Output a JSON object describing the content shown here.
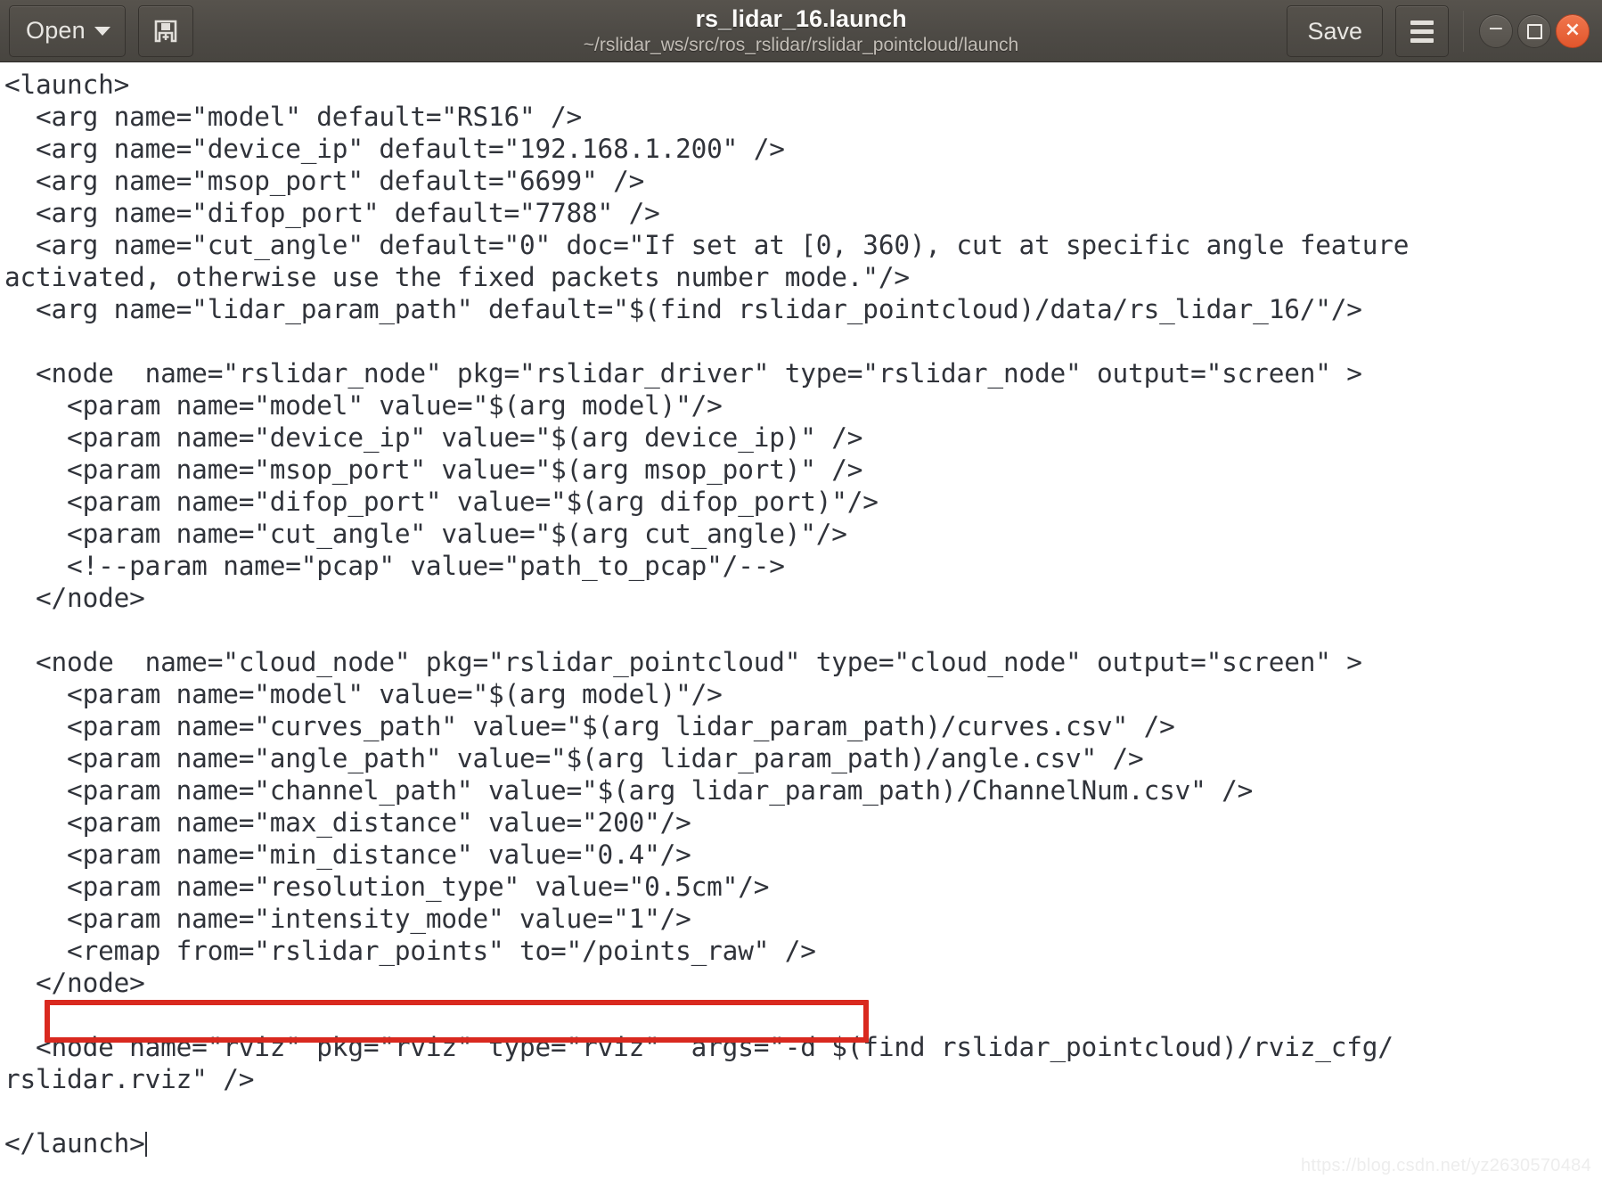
{
  "titlebar": {
    "open_label": "Open",
    "open_icon": "chevron-down-icon",
    "new_doc_icon": "save-as-document-icon",
    "title": "rs_lidar_16.launch",
    "path": "~/rslidar_ws/src/ros_rslidar/rslidar_pointcloud/launch",
    "save_label": "Save",
    "menu_icon": "hamburger-menu-icon",
    "minimize_glyph": "−",
    "maximize_glyph": "□",
    "close_glyph": "×",
    "colors": {
      "bar_background": "#4d4a45",
      "close_button": "#e2562c",
      "text": "#fbfaf8"
    }
  },
  "editor": {
    "colors": {
      "background": "#ffffff",
      "text": "#30333a",
      "highlight_border": "#d9291f"
    },
    "highlight": {
      "target_line": "<remap from=\"rslidar_points\" to=\"/points_raw\" />"
    },
    "content": "<launch>\n  <arg name=\"model\" default=\"RS16\" />\n  <arg name=\"device_ip\" default=\"192.168.1.200\" />\n  <arg name=\"msop_port\" default=\"6699\" />\n  <arg name=\"difop_port\" default=\"7788\" />\n  <arg name=\"cut_angle\" default=\"0\" doc=\"If set at [0, 360), cut at specific angle feature\nactivated, otherwise use the fixed packets number mode.\"/>\n  <arg name=\"lidar_param_path\" default=\"$(find rslidar_pointcloud)/data/rs_lidar_16/\"/>\n\n  <node  name=\"rslidar_node\" pkg=\"rslidar_driver\" type=\"rslidar_node\" output=\"screen\" >\n    <param name=\"model\" value=\"$(arg model)\"/>\n    <param name=\"device_ip\" value=\"$(arg device_ip)\" />\n    <param name=\"msop_port\" value=\"$(arg msop_port)\" />\n    <param name=\"difop_port\" value=\"$(arg difop_port)\"/>\n    <param name=\"cut_angle\" value=\"$(arg cut_angle)\"/>\n    <!--param name=\"pcap\" value=\"path_to_pcap\"/-->\n  </node>\n\n  <node  name=\"cloud_node\" pkg=\"rslidar_pointcloud\" type=\"cloud_node\" output=\"screen\" >\n    <param name=\"model\" value=\"$(arg model)\"/>\n    <param name=\"curves_path\" value=\"$(arg lidar_param_path)/curves.csv\" />\n    <param name=\"angle_path\" value=\"$(arg lidar_param_path)/angle.csv\" />\n    <param name=\"channel_path\" value=\"$(arg lidar_param_path)/ChannelNum.csv\" />\n    <param name=\"max_distance\" value=\"200\"/>\n    <param name=\"min_distance\" value=\"0.4\"/>\n    <param name=\"resolution_type\" value=\"0.5cm\"/>\n    <param name=\"intensity_mode\" value=\"1\"/>\n    <remap from=\"rslidar_points\" to=\"/points_raw\" />\n  </node>\n\n  <node name=\"rviz\" pkg=\"rviz\" type=\"rviz\"  args=\"-d $(find rslidar_pointcloud)/rviz_cfg/\nrslidar.rviz\" />\n\n</launch>"
  },
  "watermark": {
    "text": "https://blog.csdn.net/yz2630570484"
  }
}
